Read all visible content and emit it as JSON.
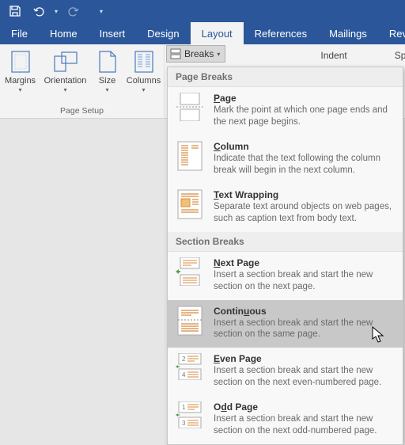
{
  "qat": {
    "save": "Save",
    "undo": "Undo",
    "redo": "Redo",
    "customize": "Customize"
  },
  "tabs": {
    "file": "File",
    "home": "Home",
    "insert": "Insert",
    "design": "Design",
    "layout": "Layout",
    "references": "References",
    "mailings": "Mailings",
    "review": "Revie"
  },
  "pagesetup": {
    "margins": "Margins",
    "orientation": "Orientation",
    "size": "Size",
    "columns": "Columns",
    "label": "Page Setup"
  },
  "breaks_btn": "Breaks",
  "indent_label": "Indent",
  "spacing_label": "Spacing",
  "dropdown": {
    "page_breaks_header": "Page Breaks",
    "section_breaks_header": "Section Breaks",
    "items": [
      {
        "title_u": "P",
        "title_rest": "age",
        "desc": "Mark the point at which one page ends and the next page begins."
      },
      {
        "title_u": "C",
        "title_rest": "olumn",
        "desc": "Indicate that the text following the column break will begin in the next column."
      },
      {
        "title_u": "T",
        "title_rest": "ext Wrapping",
        "desc": "Separate text around objects on web pages, such as caption text from body text."
      },
      {
        "title_u": "N",
        "title_rest": "ext Page",
        "desc": "Insert a section break and start the new section on the next page."
      },
      {
        "title_pre": "Contin",
        "title_u": "u",
        "title_rest": "ous",
        "desc": "Insert a section break and start the new section on the same page."
      },
      {
        "title_u": "E",
        "title_rest": "ven Page",
        "desc": "Insert a section break and start the new section on the next even-numbered page."
      },
      {
        "title_pre": "O",
        "title_u": "d",
        "title_rest": "d Page",
        "desc": "Insert a section break and start the new section on the next odd-numbered page."
      }
    ]
  }
}
